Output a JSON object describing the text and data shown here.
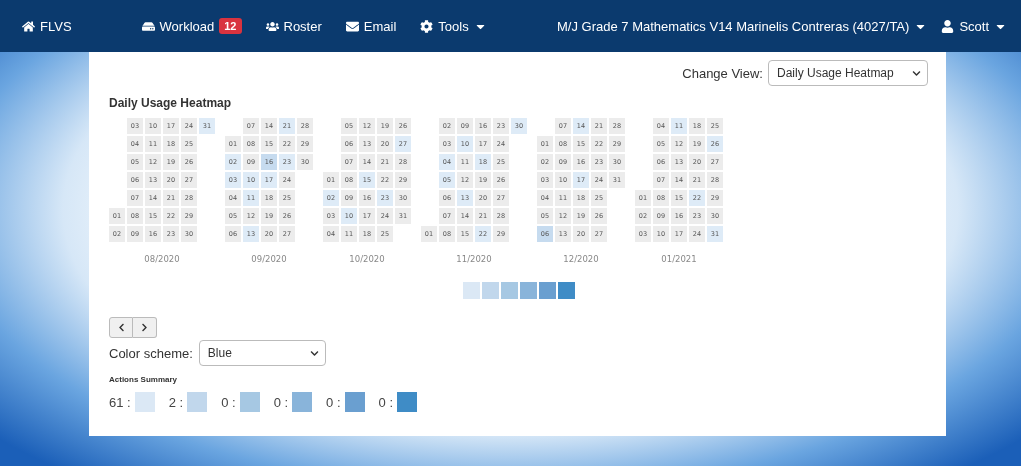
{
  "navbar": {
    "brand": "FLVS",
    "items": [
      {
        "label": "Workload",
        "kind": "badge",
        "badge": "12"
      },
      {
        "label": "Roster",
        "kind": "plain"
      },
      {
        "label": "Email",
        "kind": "plain"
      },
      {
        "label": "Tools",
        "kind": "dropdown"
      }
    ],
    "course": "M/J Grade 7 Mathematics V14 Marinelis Contreras (4027/TA)",
    "user": "Scott"
  },
  "view": {
    "label": "Change View:",
    "value": "Daily Usage Heatmap"
  },
  "heatmap": {
    "title": "Daily Usage Heatmap",
    "months": [
      {
        "label": "08/2020",
        "weeks": [
          [
            {
              "day": "01"
            },
            {
              "day": "02"
            }
          ],
          [
            {
              "day": "03"
            },
            {
              "day": "04"
            },
            {
              "day": "05"
            },
            {
              "day": "06"
            },
            {
              "day": "07"
            },
            {
              "day": "08"
            },
            {
              "day": "09"
            }
          ],
          [
            {
              "day": "10"
            },
            {
              "day": "11"
            },
            {
              "day": "12"
            },
            {
              "day": "13"
            },
            {
              "day": "14"
            },
            {
              "day": "15"
            },
            {
              "day": "16"
            }
          ],
          [
            {
              "day": "17"
            },
            {
              "day": "18"
            },
            {
              "day": "19"
            },
            {
              "day": "20"
            },
            {
              "day": "21"
            },
            {
              "day": "22"
            },
            {
              "day": "23"
            }
          ],
          [
            {
              "day": "24"
            },
            {
              "day": "25"
            },
            {
              "day": "26"
            },
            {
              "day": "27"
            },
            {
              "day": "28"
            },
            {
              "day": "29"
            },
            {
              "day": "30"
            }
          ],
          [
            {
              "day": "31",
              "color": "#deebf7"
            }
          ]
        ]
      },
      {
        "label": "09/2020",
        "weeks": [
          [
            {
              "day": "01"
            },
            {
              "day": "02",
              "color": "#deebf7"
            },
            {
              "day": "03",
              "color": "#deebf7"
            },
            {
              "day": "04"
            },
            {
              "day": "05"
            },
            {
              "day": "06"
            }
          ],
          [
            {
              "day": "07"
            },
            {
              "day": "08"
            },
            {
              "day": "09"
            },
            {
              "day": "10",
              "color": "#deebf7"
            },
            {
              "day": "11",
              "color": "#deebf7"
            },
            {
              "day": "12"
            },
            {
              "day": "13",
              "color": "#deebf7"
            }
          ],
          [
            {
              "day": "14"
            },
            {
              "day": "15"
            },
            {
              "day": "16",
              "color": "#c6dbef"
            },
            {
              "day": "17",
              "color": "#deebf7"
            },
            {
              "day": "18"
            },
            {
              "day": "19"
            },
            {
              "day": "20"
            }
          ],
          [
            {
              "day": "21",
              "color": "#deebf7"
            },
            {
              "day": "22"
            },
            {
              "day": "23",
              "color": "#deebf7"
            },
            {
              "day": "24"
            },
            {
              "day": "25"
            },
            {
              "day": "26"
            },
            {
              "day": "27"
            }
          ],
          [
            {
              "day": "28"
            },
            {
              "day": "29"
            },
            {
              "day": "30"
            }
          ]
        ]
      },
      {
        "label": "10/2020",
        "weeks": [
          [
            {
              "day": "01"
            },
            {
              "day": "02",
              "color": "#deebf7"
            },
            {
              "day": "03"
            },
            {
              "day": "04"
            }
          ],
          [
            {
              "day": "05"
            },
            {
              "day": "06"
            },
            {
              "day": "07"
            },
            {
              "day": "08"
            },
            {
              "day": "09"
            },
            {
              "day": "10",
              "color": "#deebf7"
            },
            {
              "day": "11"
            }
          ],
          [
            {
              "day": "12"
            },
            {
              "day": "13"
            },
            {
              "day": "14"
            },
            {
              "day": "15",
              "color": "#deebf7"
            },
            {
              "day": "16"
            },
            {
              "day": "17"
            },
            {
              "day": "18"
            }
          ],
          [
            {
              "day": "19"
            },
            {
              "day": "20"
            },
            {
              "day": "21"
            },
            {
              "day": "22"
            },
            {
              "day": "23",
              "color": "#deebf7"
            },
            {
              "day": "24"
            },
            {
              "day": "25"
            }
          ],
          [
            {
              "day": "26"
            },
            {
              "day": "27",
              "color": "#deebf7"
            },
            {
              "day": "28"
            },
            {
              "day": "29"
            },
            {
              "day": "30"
            },
            {
              "day": "31"
            }
          ]
        ]
      },
      {
        "label": "11/2020",
        "weeks": [
          [
            {
              "day": "01"
            }
          ],
          [
            {
              "day": "02"
            },
            {
              "day": "03"
            },
            {
              "day": "04",
              "color": "#deebf7"
            },
            {
              "day": "05",
              "color": "#deebf7"
            },
            {
              "day": "06"
            },
            {
              "day": "07"
            },
            {
              "day": "08"
            }
          ],
          [
            {
              "day": "09"
            },
            {
              "day": "10",
              "color": "#deebf7"
            },
            {
              "day": "11"
            },
            {
              "day": "12"
            },
            {
              "day": "13",
              "color": "#deebf7"
            },
            {
              "day": "14"
            },
            {
              "day": "15"
            }
          ],
          [
            {
              "day": "16"
            },
            {
              "day": "17"
            },
            {
              "day": "18",
              "color": "#deebf7"
            },
            {
              "day": "19"
            },
            {
              "day": "20"
            },
            {
              "day": "21"
            },
            {
              "day": "22",
              "color": "#deebf7"
            }
          ],
          [
            {
              "day": "23"
            },
            {
              "day": "24"
            },
            {
              "day": "25"
            },
            {
              "day": "26"
            },
            {
              "day": "27"
            },
            {
              "day": "28"
            },
            {
              "day": "29"
            }
          ],
          [
            {
              "day": "30",
              "color": "#deebf7"
            }
          ]
        ]
      },
      {
        "label": "12/2020",
        "weeks": [
          [
            {
              "day": "01"
            },
            {
              "day": "02"
            },
            {
              "day": "03"
            },
            {
              "day": "04"
            },
            {
              "day": "05"
            },
            {
              "day": "06",
              "color": "#c6dbef"
            }
          ],
          [
            {
              "day": "07"
            },
            {
              "day": "08"
            },
            {
              "day": "09"
            },
            {
              "day": "10"
            },
            {
              "day": "11"
            },
            {
              "day": "12"
            },
            {
              "day": "13"
            }
          ],
          [
            {
              "day": "14",
              "color": "#deebf7"
            },
            {
              "day": "15"
            },
            {
              "day": "16"
            },
            {
              "day": "17",
              "color": "#deebf7"
            },
            {
              "day": "18"
            },
            {
              "day": "19"
            },
            {
              "day": "20"
            }
          ],
          [
            {
              "day": "21"
            },
            {
              "day": "22"
            },
            {
              "day": "23"
            },
            {
              "day": "24"
            },
            {
              "day": "25"
            },
            {
              "day": "26"
            },
            {
              "day": "27"
            }
          ],
          [
            {
              "day": "28"
            },
            {
              "day": "29"
            },
            {
              "day": "30"
            },
            {
              "day": "31"
            }
          ]
        ]
      },
      {
        "label": "01/2021",
        "weeks": [
          [
            {
              "day": "01"
            },
            {
              "day": "02"
            },
            {
              "day": "03"
            }
          ],
          [
            {
              "day": "04"
            },
            {
              "day": "05"
            },
            {
              "day": "06"
            },
            {
              "day": "07"
            },
            {
              "day": "08"
            },
            {
              "day": "09"
            },
            {
              "day": "10"
            }
          ],
          [
            {
              "day": "11",
              "color": "#deebf7"
            },
            {
              "day": "12"
            },
            {
              "day": "13"
            },
            {
              "day": "14"
            },
            {
              "day": "15"
            },
            {
              "day": "16"
            },
            {
              "day": "17"
            }
          ],
          [
            {
              "day": "18"
            },
            {
              "day": "19"
            },
            {
              "day": "20"
            },
            {
              "day": "21"
            },
            {
              "day": "22",
              "color": "#deebf7"
            },
            {
              "day": "23"
            },
            {
              "day": "24"
            }
          ],
          [
            {
              "day": "25"
            },
            {
              "day": "26",
              "color": "#deebf7"
            },
            {
              "day": "27"
            },
            {
              "day": "28"
            },
            {
              "day": "29"
            },
            {
              "day": "30"
            },
            {
              "day": "31",
              "color": "#deebf7"
            }
          ]
        ]
      }
    ],
    "legend": [
      {
        "color": "#dbe8f5"
      },
      {
        "color": "#c1d7ec"
      },
      {
        "color": "#a6c8e3"
      },
      {
        "color": "#89b4da"
      },
      {
        "color": "#6a9fd0"
      },
      {
        "color": "#3f8cc6"
      }
    ]
  },
  "color_scheme": {
    "label": "Color scheme:",
    "value": "Blue"
  },
  "summary": {
    "title": "Actions Summary",
    "items": [
      {
        "count": "61 :",
        "color": "#dbe8f5"
      },
      {
        "count": "2 :",
        "color": "#c1d7ec"
      },
      {
        "count": "0 :",
        "color": "#a6c8e3"
      },
      {
        "count": "0 :",
        "color": "#89b4da"
      },
      {
        "count": "0 :",
        "color": "#6a9fd0"
      },
      {
        "count": "0 :",
        "color": "#3f8cc6"
      }
    ]
  }
}
